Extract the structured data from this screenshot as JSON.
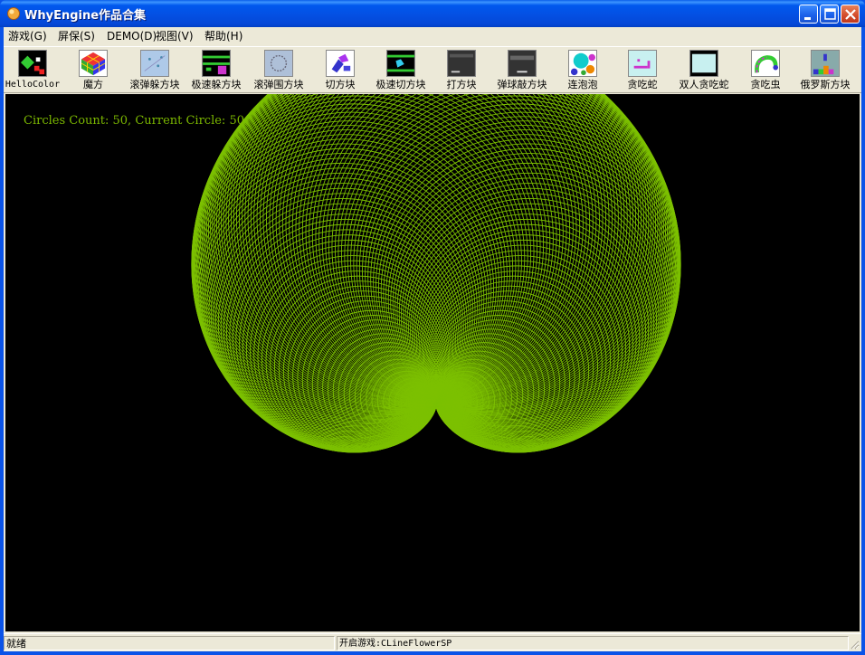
{
  "window": {
    "title": "WhyEngine作品合集",
    "colors": {
      "titlebar": "#0450E3",
      "frame": "#ECE9D8",
      "canvas_bg": "#000000"
    }
  },
  "menu": {
    "items": [
      {
        "label": "游戏(G)"
      },
      {
        "label": "屏保(S)"
      },
      {
        "label": "DEMO(D)"
      },
      {
        "label": "视图(V)"
      },
      {
        "label": "帮助(H)"
      }
    ]
  },
  "toolbar": {
    "items": [
      {
        "label": "HelloColor",
        "icon": "hellocolor-icon"
      },
      {
        "label": "魔方",
        "icon": "rubiks-cube-icon"
      },
      {
        "label": "滚弹躲方块",
        "icon": "bounce-dodge-icon"
      },
      {
        "label": "极速躲方块",
        "icon": "speed-dodge-icon"
      },
      {
        "label": "滚弹围方块",
        "icon": "bounce-surround-icon"
      },
      {
        "label": "切方块",
        "icon": "cut-block-icon"
      },
      {
        "label": "极速切方块",
        "icon": "speed-cut-icon"
      },
      {
        "label": "打方块",
        "icon": "hit-block-icon"
      },
      {
        "label": "弹球敲方块",
        "icon": "pinball-block-icon"
      },
      {
        "label": "连泡泡",
        "icon": "bubble-icon"
      },
      {
        "label": "贪吃蛇",
        "icon": "snake-icon"
      },
      {
        "label": "双人贪吃蛇",
        "icon": "two-player-snake-icon"
      },
      {
        "label": "贪吃虫",
        "icon": "worm-icon"
      },
      {
        "label": "俄罗斯方块",
        "icon": "tetris-icon"
      }
    ]
  },
  "canvas": {
    "info": "Circles Count: 50, Current Circle: 50",
    "circles_count": 50,
    "current_circle": 50,
    "stroke_color": "#7CC000"
  },
  "status": {
    "left": "就绪",
    "right": "开启游戏:CLineFlowerSP"
  }
}
